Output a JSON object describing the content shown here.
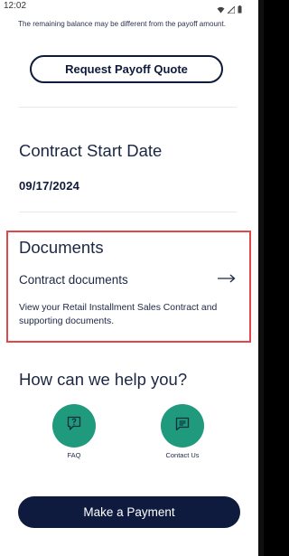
{
  "status_bar": {
    "time": "12:02",
    "icons": [
      "wifi-icon",
      "signal-icon",
      "battery-icon"
    ]
  },
  "payoff": {
    "disclaimer": "The remaining balance may be different from the payoff amount.",
    "button_label": "Request Payoff Quote"
  },
  "contract_start": {
    "title": "Contract Start Date",
    "date": "09/17/2024"
  },
  "documents": {
    "title": "Documents",
    "link_label": "Contract documents",
    "description": "View your Retail Installment Sales Contract and supporting documents.",
    "highlight_color": "#e0474a"
  },
  "help": {
    "title": "How can we help you?",
    "items": [
      {
        "label": "FAQ",
        "icon": "faq-icon"
      },
      {
        "label": "Contact Us",
        "icon": "chat-message-icon"
      }
    ],
    "accent_color": "#1f9a7c"
  },
  "footer": {
    "pay_button_label": "Make a Payment",
    "brand_color": "#0e1b3e"
  }
}
